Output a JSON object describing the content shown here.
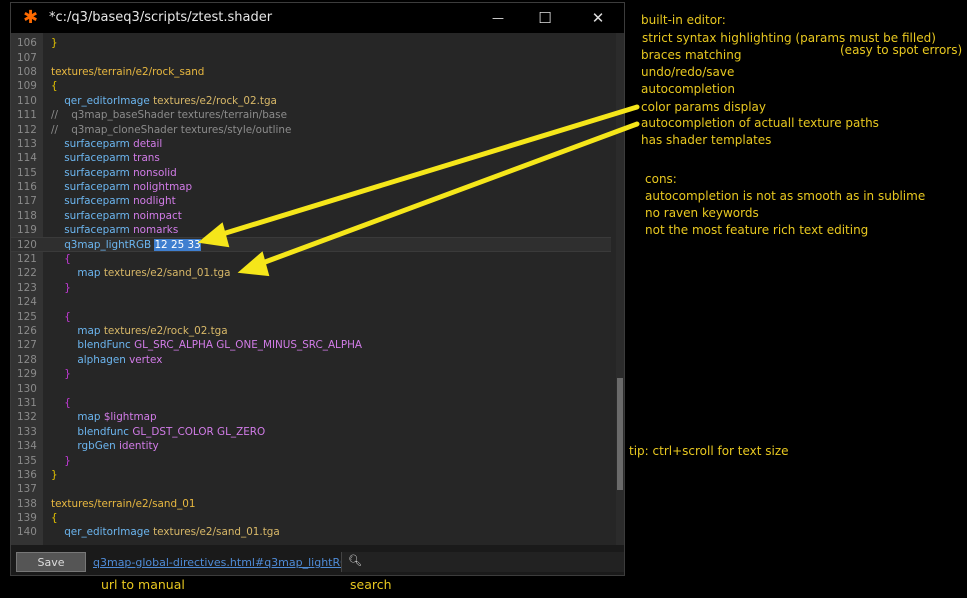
{
  "window": {
    "title": "*c:/q3/baseq3/scripts/ztest.shader",
    "minimize_glyph": "—",
    "maximize_glyph": "☐",
    "close_glyph": "✕"
  },
  "editor": {
    "lines": [
      {
        "n": "106",
        "t": [
          [
            "}",
            "t-brace-y"
          ]
        ]
      },
      {
        "n": "107",
        "t": []
      },
      {
        "n": "108",
        "t": [
          [
            "textures/terrain/e2/rock_sand",
            "t-path"
          ]
        ]
      },
      {
        "n": "109",
        "t": [
          [
            "{",
            "t-brace-y"
          ]
        ]
      },
      {
        "n": "110",
        "t": [
          [
            "    qer_editorImage ",
            "t-kw"
          ],
          [
            "textures/e2/rock_02.tga",
            "t-tex"
          ]
        ]
      },
      {
        "n": "111",
        "t": [
          [
            "//    q3map_baseShader textures/terrain/base",
            "t-com"
          ]
        ]
      },
      {
        "n": "112",
        "t": [
          [
            "//    q3map_cloneShader textures/style/outline",
            "t-com"
          ]
        ]
      },
      {
        "n": "113",
        "t": [
          [
            "    surfaceparm ",
            "t-kw"
          ],
          [
            "detail",
            "t-val"
          ]
        ]
      },
      {
        "n": "114",
        "t": [
          [
            "    surfaceparm ",
            "t-kw"
          ],
          [
            "trans",
            "t-val"
          ]
        ]
      },
      {
        "n": "115",
        "t": [
          [
            "    surfaceparm ",
            "t-kw"
          ],
          [
            "nonsolid",
            "t-val"
          ]
        ]
      },
      {
        "n": "116",
        "t": [
          [
            "    surfaceparm ",
            "t-kw"
          ],
          [
            "nolightmap",
            "t-val"
          ]
        ]
      },
      {
        "n": "117",
        "t": [
          [
            "    surfaceparm ",
            "t-kw"
          ],
          [
            "nodlight",
            "t-val"
          ]
        ]
      },
      {
        "n": "118",
        "t": [
          [
            "    surfaceparm ",
            "t-kw"
          ],
          [
            "noimpact",
            "t-val"
          ]
        ]
      },
      {
        "n": "119",
        "t": [
          [
            "    surfaceparm ",
            "t-kw"
          ],
          [
            "nomarks",
            "t-val"
          ]
        ]
      },
      {
        "n": "120",
        "cur": true,
        "t": [
          [
            "    q3map_lightRGB ",
            "t-kw"
          ],
          [
            "12 25 33",
            "t-sel"
          ]
        ]
      },
      {
        "n": "121",
        "t": [
          [
            "    {",
            "t-brace-m"
          ]
        ]
      },
      {
        "n": "122",
        "t": [
          [
            "        map ",
            "t-kw"
          ],
          [
            "textures/e2/sand_01.tga",
            "t-tex"
          ]
        ]
      },
      {
        "n": "123",
        "t": [
          [
            "    }",
            "t-brace-m"
          ]
        ]
      },
      {
        "n": "124",
        "t": []
      },
      {
        "n": "125",
        "t": [
          [
            "    {",
            "t-brace-m"
          ]
        ]
      },
      {
        "n": "126",
        "t": [
          [
            "        map ",
            "t-kw"
          ],
          [
            "textures/e2/rock_02.tga",
            "t-tex"
          ]
        ]
      },
      {
        "n": "127",
        "t": [
          [
            "        blendFunc ",
            "t-kw"
          ],
          [
            "GL_SRC_ALPHA GL_ONE_MINUS_SRC_ALPHA",
            "t-val"
          ]
        ]
      },
      {
        "n": "128",
        "t": [
          [
            "        alphagen ",
            "t-kw"
          ],
          [
            "vertex",
            "t-val"
          ]
        ]
      },
      {
        "n": "129",
        "t": [
          [
            "    }",
            "t-brace-m"
          ]
        ]
      },
      {
        "n": "130",
        "t": []
      },
      {
        "n": "131",
        "t": [
          [
            "    {",
            "t-brace-m"
          ]
        ]
      },
      {
        "n": "132",
        "t": [
          [
            "        map ",
            "t-kw"
          ],
          [
            "$lightmap",
            "t-val"
          ]
        ]
      },
      {
        "n": "133",
        "t": [
          [
            "        blendfunc ",
            "t-kw"
          ],
          [
            "GL_DST_COLOR GL_ZERO",
            "t-val"
          ]
        ]
      },
      {
        "n": "134",
        "t": [
          [
            "        rgbGen ",
            "t-kw"
          ],
          [
            "identity",
            "t-val"
          ]
        ]
      },
      {
        "n": "135",
        "t": [
          [
            "    }",
            "t-brace-m"
          ]
        ]
      },
      {
        "n": "136",
        "t": [
          [
            "}",
            "t-brace-y"
          ]
        ]
      },
      {
        "n": "137",
        "t": []
      },
      {
        "n": "138",
        "t": [
          [
            "textures/terrain/e2/sand_01",
            "t-path"
          ]
        ]
      },
      {
        "n": "139",
        "t": [
          [
            "{",
            "t-brace-y"
          ]
        ]
      },
      {
        "n": "140",
        "t": [
          [
            "    qer_editorImage ",
            "t-kw"
          ],
          [
            "textures/e2/sand_01.tga",
            "t-tex"
          ]
        ]
      }
    ]
  },
  "bottombar": {
    "save_label": "Save",
    "manual_link": "q3map-global-directives.html#q3map_lightRGB",
    "search_icon": "search-icon"
  },
  "notes": {
    "builtin_header": "built-in editor:",
    "builtin_items": [
      "strict syntax highlighting (params must be filled)",
      "braces matching",
      "undo/redo/save",
      "autocompletion",
      "color params display",
      "autocompletion of actuall texture paths",
      "has shader templates"
    ],
    "easy_errors": "(easy to spot errors)",
    "cons_header": "cons:",
    "cons_items": [
      "autocompletion is not as smooth as in sublime",
      "no raven keywords",
      "not the most feature rich text editing"
    ],
    "tip": "tip: ctrl+scroll for text size",
    "url_caption": "url to manual",
    "search_caption": "search"
  },
  "colors": {
    "annotation": "#e8c820",
    "arrow": "#f5e61a",
    "selection": "#3f7fd0"
  }
}
